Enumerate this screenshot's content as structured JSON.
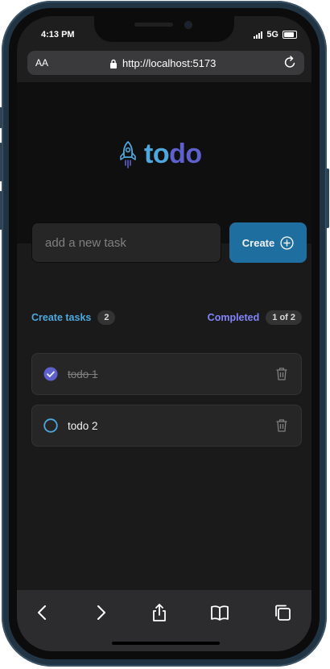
{
  "status_bar": {
    "time": "4:13 PM",
    "network": "5G"
  },
  "browser": {
    "text_size_label": "AA",
    "url": "http://localhost:5173",
    "icons": [
      "lock-icon",
      "reload-icon"
    ]
  },
  "app": {
    "logo_text_part1": "to",
    "logo_text_part2": "do",
    "input_placeholder": "add a new task",
    "input_value": "",
    "create_label": "Create",
    "colors": {
      "blue": "#4ea8de",
      "purple": "#5e60ce",
      "purple_light": "#8284fa",
      "button": "#1e6f9f"
    }
  },
  "counters": {
    "created_label": "Create tasks",
    "created_count": "2",
    "completed_label": "Completed",
    "completed_count": "1 of 2"
  },
  "tasks": [
    {
      "text": "todo 1",
      "completed": true
    },
    {
      "text": "todo 2",
      "completed": false
    }
  ],
  "toolbar": {
    "icons": [
      "back-icon",
      "forward-icon",
      "share-icon",
      "bookmarks-icon",
      "tabs-icon"
    ]
  }
}
